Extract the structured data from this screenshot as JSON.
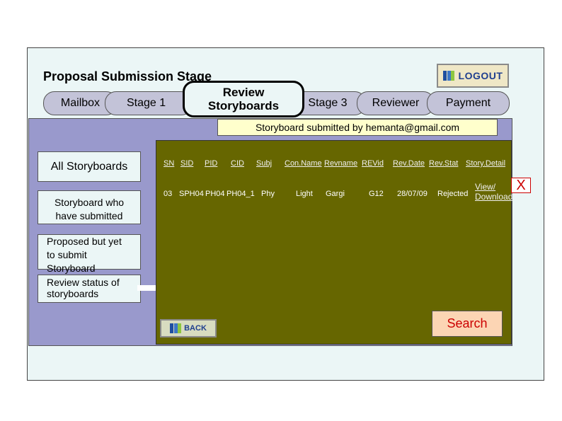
{
  "header": {
    "title": "Proposal Submission Stage",
    "logout_label": "LOGOUT"
  },
  "tabs": {
    "mailbox": "Mailbox",
    "stage1": "Stage 1",
    "review_line1": "Review",
    "review_line2": "Storyboards",
    "stage3": "Stage 3",
    "reviewer": "Reviewer",
    "payment": "Payment"
  },
  "banner": "Storyboard submitted by hemanta@gmail.com",
  "sidebar": {
    "all": "All Storyboards",
    "submitted_line1": "Storyboard who",
    "submitted_line2": "have submitted",
    "proposed_line1": "Proposed but yet",
    "proposed_line2": "to submit",
    "proposed_line3": "Storyboard",
    "review_line1": "Review status of",
    "review_line2": "storyboards"
  },
  "table": {
    "headers": {
      "sn": "SN",
      "sid": "SID",
      "pid": "PID",
      "cid": "CID",
      "subj": "Subj",
      "conname": "Con.Name",
      "revname": "Revname",
      "revid": "REVid",
      "revdate": "Rev.Date",
      "revstat": "Rev.Stat",
      "detail": "Story.Detail"
    },
    "row": {
      "sn": "03",
      "sid": "SPH04",
      "pid": "PH04",
      "cid": "PH04_1",
      "subj": "Phy",
      "conname": "Light",
      "revname": "Gargi",
      "revid": "G12",
      "revdate": "28/07/09",
      "revstat": "Rejected",
      "view": "View/",
      "download": "Download"
    }
  },
  "close_label": "X",
  "search_label": "Search",
  "back_label": "BACK",
  "colors": {
    "panel": "#9999cc",
    "content": "#666600",
    "banner": "#ffffcc",
    "search_bg": "#fcd5b4",
    "accent_red": "#cc0000"
  }
}
